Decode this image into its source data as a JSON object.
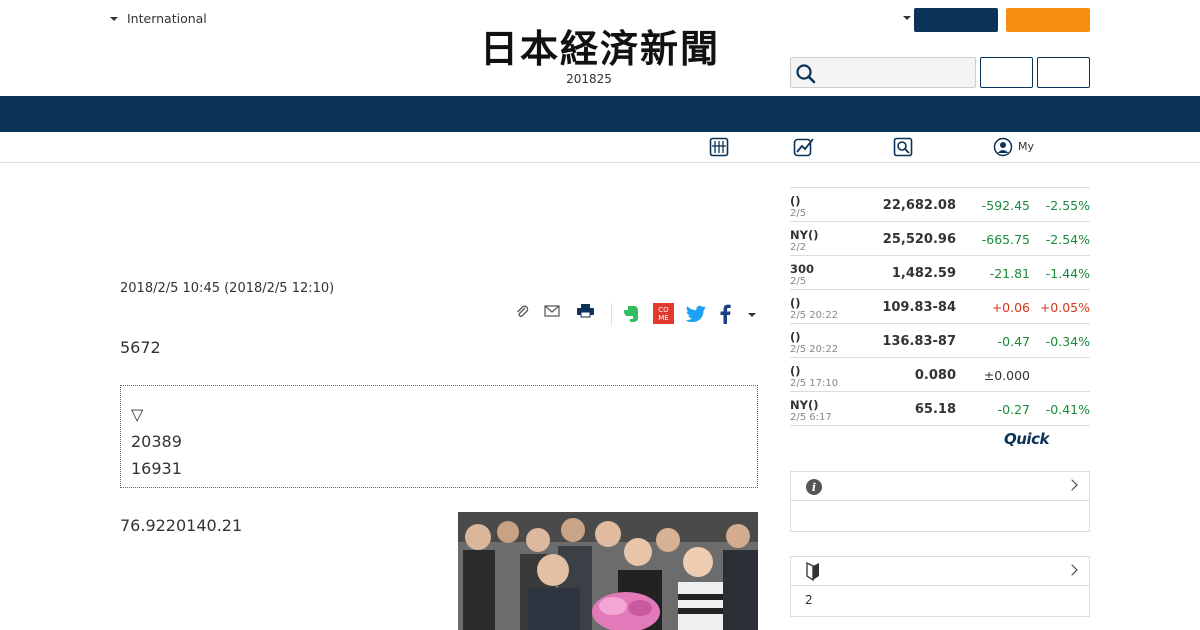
{
  "header": {
    "edition_label": "International",
    "date_code": "201825"
  },
  "article": {
    "published": "2018/2/5 10:45 (2018/2/5 12:10)",
    "lead": "5672",
    "summary": {
      "marker": "▽",
      "line1": "20389",
      "line2": "16931"
    },
    "body": "76.9220140.21"
  },
  "subnav": {
    "my_label": "My"
  },
  "market": {
    "rows": [
      {
        "name": "()",
        "date": "2/5",
        "value": "22,682.08",
        "change": "-592.45",
        "pct": "-2.55%"
      },
      {
        "name": "NY()",
        "date": "2/2",
        "value": "25,520.96",
        "change": "-665.75",
        "pct": "-2.54%"
      },
      {
        "name": "300",
        "date": "2/5",
        "value": "1,482.59",
        "change": "-21.81",
        "pct": "-1.44%"
      },
      {
        "name": "()",
        "date": "2/5 20:22",
        "value": "109.83-84",
        "change": "+0.06",
        "pct": "+0.05%"
      },
      {
        "name": "()",
        "date": "2/5 20:22",
        "value": "136.83-87",
        "change": "-0.47",
        "pct": "-0.34%"
      },
      {
        "name": "()",
        "date": "2/5 17:10",
        "value": "0.080",
        "change": "±0.000",
        "pct": ""
      },
      {
        "name": "NY()",
        "date": "2/5 6:17",
        "value": "65.18",
        "change": "-0.27",
        "pct": "-0.41%"
      }
    ],
    "provider_logo": "Quick"
  },
  "side_boxes": {
    "box2_body": "2"
  },
  "colors": {
    "navy": "#0b3257",
    "orange": "#f68d12",
    "down": "#1a8a3a",
    "up": "#d6361c"
  },
  "icons": [
    "search-icon",
    "newspaper-icon",
    "chart-icon",
    "search-square-icon",
    "user-circle-icon",
    "clip-icon",
    "mail-icon",
    "print-icon",
    "evernote-icon",
    "come-icon",
    "twitter-icon",
    "facebook-icon",
    "info-icon",
    "beginner-icon"
  ]
}
